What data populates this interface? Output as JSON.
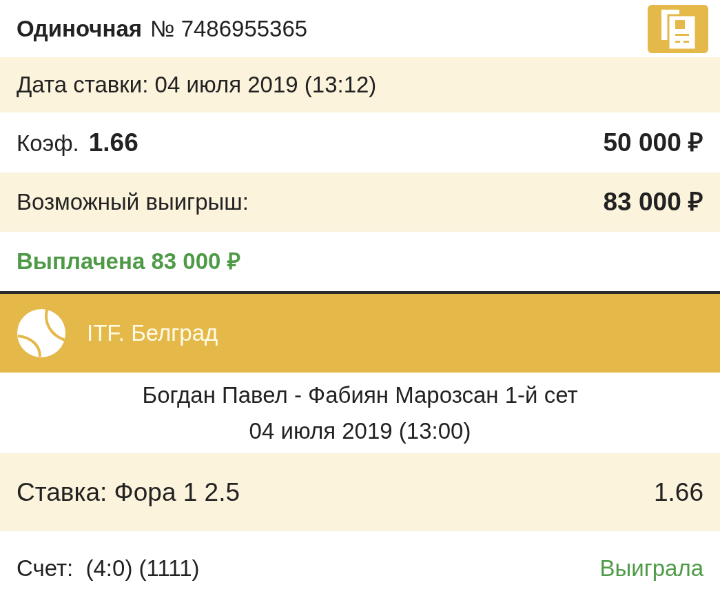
{
  "header": {
    "type": "Одиночная",
    "number": "№ 7486955365"
  },
  "bet_date": "Дата ставки: 04 июля 2019 (13:12)",
  "odds": {
    "label": "Коэф.",
    "value": "1.66",
    "stake": "50 000 ₽"
  },
  "possible_win": {
    "label": "Возможный выигрыш:",
    "value": "83 000 ₽"
  },
  "payout": "Выплачена 83 000 ₽",
  "event": {
    "tournament": "ITF. Белград",
    "match": "Богдан Павел - Фабиян Марозсан 1-й сет",
    "date": "04 июля 2019 (13:00)",
    "bet_label": "Ставка: Фора 1 2.5",
    "bet_odds": "1.66",
    "score": "Счет:  (4:0) (1111)",
    "result": "Выиграла",
    "won": true
  }
}
